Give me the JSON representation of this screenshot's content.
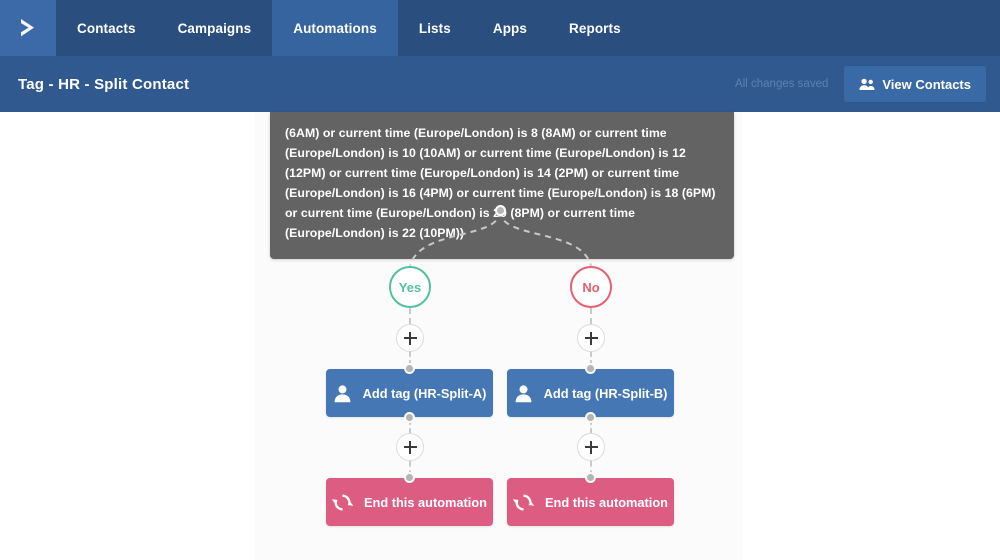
{
  "app": {
    "logo_icon": "chevron-right-logo",
    "brand_color": "#2a4e7e"
  },
  "topnav": {
    "items": [
      {
        "label": "Contacts",
        "active": false
      },
      {
        "label": "Campaigns",
        "active": false
      },
      {
        "label": "Automations",
        "active": true
      },
      {
        "label": "Lists",
        "active": false
      },
      {
        "label": "Apps",
        "active": false
      },
      {
        "label": "Reports",
        "active": false
      }
    ]
  },
  "subheader": {
    "title": "Tag - HR - Split Contact",
    "status_text": "All changes saved",
    "view_contacts_label": "View Contacts",
    "view_contacts_icon": "users-icon"
  },
  "canvas": {
    "condition_box": {
      "text": "(6AM) or current time (Europe/London) is 8 (8AM) or current time (Europe/London) is 10 (10AM) or current time (Europe/London) is 12 (12PM) or current time (Europe/London) is 14 (2PM) or current time (Europe/London) is 16 (4PM) or current time (Europe/London) is 18 (6PM) or current time (Europe/London) is 20 (8PM) or current time (Europe/London) is 22 (10PM))",
      "background_color": "#636363"
    },
    "branches": [
      {
        "condition_label": "Yes",
        "condition_color": "#54c0a0",
        "add_step_label": "+",
        "steps": [
          {
            "label": "Add tag (HR-Split-A)",
            "icon": "person-icon",
            "color": "#4577b5"
          },
          {
            "label": "End this automation",
            "icon": "refresh-cycle-icon",
            "color": "#dd5c82"
          }
        ]
      },
      {
        "condition_label": "No",
        "condition_color": "#e4606d",
        "add_step_label": "+",
        "steps": [
          {
            "label": "Add tag (HR-Split-B)",
            "icon": "person-icon",
            "color": "#4577b5"
          },
          {
            "label": "End this automation",
            "icon": "refresh-cycle-icon",
            "color": "#dd5c82"
          }
        ]
      }
    ]
  }
}
